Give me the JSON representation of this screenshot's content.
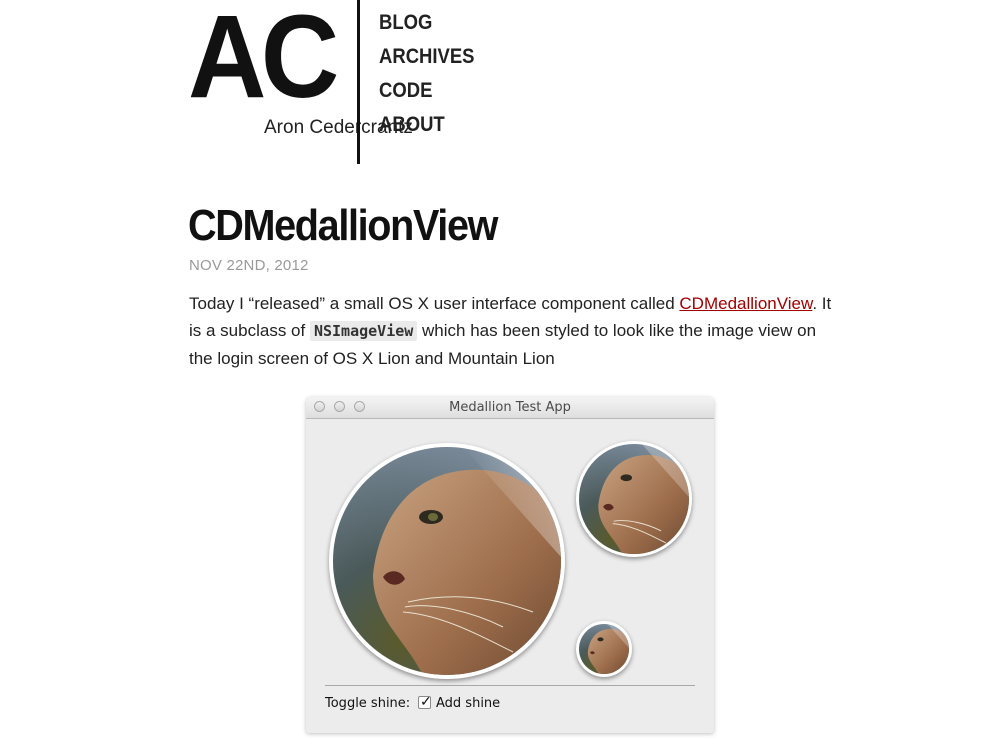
{
  "header": {
    "logo": "AC",
    "author": "Aron Cedercrantz",
    "nav": [
      "BLOG",
      "ARCHIVES",
      "CODE",
      "ABOUT"
    ]
  },
  "post": {
    "title": "CDMedallionView",
    "date": "NOV 22ND, 2012",
    "body_1": "Today I “released” a small OS X user interface component called ",
    "link": "CDMedallionView",
    "body_2": ". It is a subclass of ",
    "code": "NSImageView",
    "body_3": " which has been styled to look like the image view on the login screen of OS X Lion and Mountain Lion"
  },
  "app_window": {
    "title": "Medallion Test App",
    "toggle_label": "Toggle shine:",
    "checkbox_label": "Add shine",
    "checkbox_checked": true,
    "checkmark": "✓"
  },
  "colors": {
    "link": "#a30000",
    "date": "#999999",
    "window_bg": "#ececec"
  }
}
